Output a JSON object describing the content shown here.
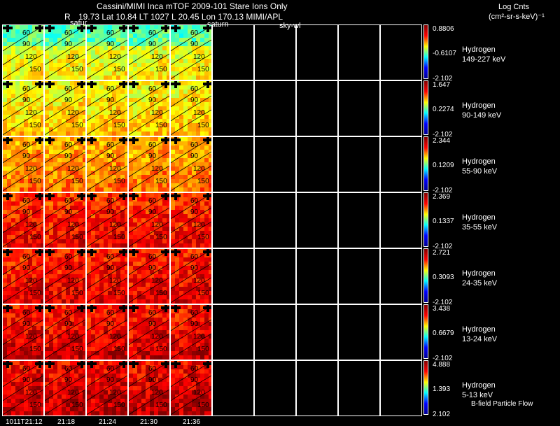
{
  "header": {
    "title": "Cassini/MIMI Inca mTOF  2009-101   Stare   Ions Only",
    "r_label": "R",
    "position_line": "19.73 Lat 10.84 LT 1027 L      20.45 Lon       170.13  MIMI/APL",
    "saturn_label_1": "satur",
    "saturn_label_2": "saturn",
    "sky_label": "sky-wl",
    "units_title": "Log Cnts",
    "units_sub": "(cm²-sr-s-keV)⁻¹",
    "footer_note": "B-field Particle Flow"
  },
  "chart_data": {
    "type": "heatmap",
    "grid": {
      "rows": 7,
      "columns": 10,
      "filled_columns": 5
    },
    "time_labels": [
      "1011T21:12",
      "21:18",
      "21:24",
      "21:30",
      "21:36"
    ],
    "contour_labels": [
      "60",
      "90",
      "120",
      "150"
    ],
    "channels": [
      {
        "species": "Hydrogen",
        "energy": "149-227 keV",
        "cmax": "0.8806",
        "cmid": "-0.6107",
        "cmin": "-2.102",
        "level": 0.55
      },
      {
        "species": "Hydrogen",
        "energy": "90-149 keV",
        "cmax": "1.647",
        "cmid": "0.2274",
        "cmin": "-2.102",
        "level": 0.6
      },
      {
        "species": "Hydrogen",
        "energy": "55-90 keV",
        "cmax": "2.344",
        "cmid": "0.1209",
        "cmin": "-2.102",
        "level": 0.68
      },
      {
        "species": "Hydrogen",
        "energy": "35-55 keV",
        "cmax": "2.369",
        "cmid": "0.1337",
        "cmin": "-2.102",
        "level": 0.8
      },
      {
        "species": "Hydrogen",
        "energy": "24-35 keV",
        "cmax": "2.721",
        "cmid": "0.3093",
        "cmin": "-2.102",
        "level": 0.82
      },
      {
        "species": "Hydrogen",
        "energy": "13-24 keV",
        "cmax": "3.438",
        "cmid": "0.6679",
        "cmin": "-2.102",
        "level": 0.84
      },
      {
        "species": "Hydrogen",
        "energy": "5-13 keV",
        "cmax": "4.888",
        "cmid": "1.393",
        "cmin": "2.102",
        "level": 0.86
      }
    ]
  }
}
